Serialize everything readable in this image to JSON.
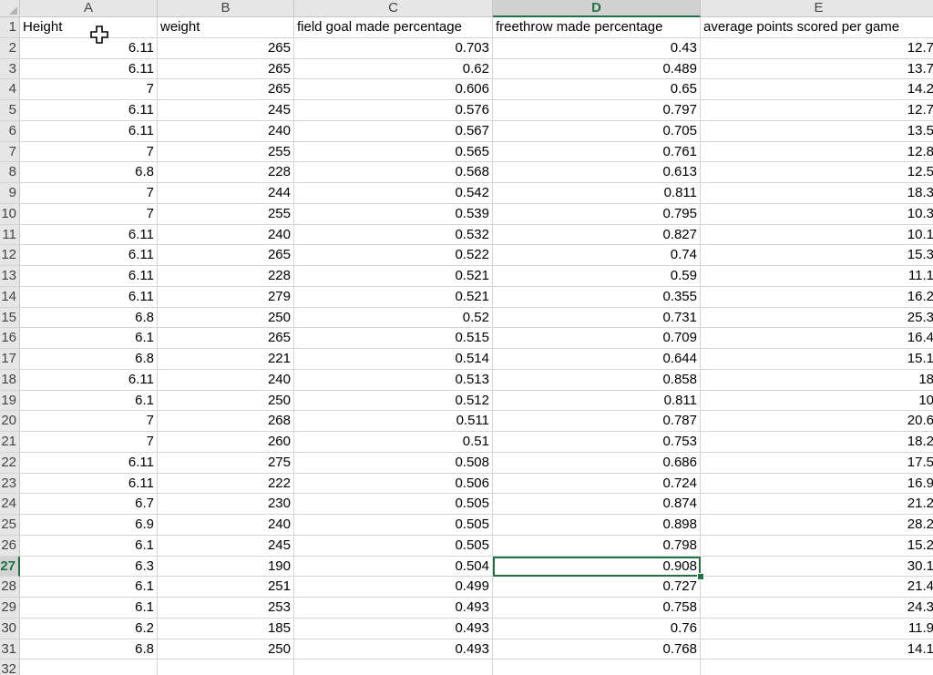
{
  "column_headers": [
    "A",
    "B",
    "C",
    "D",
    "E"
  ],
  "active_column": "D",
  "active_row": 27,
  "header_row": [
    "Height",
    "weight",
    "field goal made percentage",
    "freethrow made percentage",
    "average points scored per game"
  ],
  "rows": [
    [
      "6.11",
      "265",
      "0.703",
      "0.43",
      "12.7"
    ],
    [
      "6.11",
      "265",
      "0.62",
      "0.489",
      "13.7"
    ],
    [
      "7",
      "265",
      "0.606",
      "0.65",
      "14.2"
    ],
    [
      "6.11",
      "245",
      "0.576",
      "0.797",
      "12.7"
    ],
    [
      "6.11",
      "240",
      "0.567",
      "0.705",
      "13.5"
    ],
    [
      "7",
      "255",
      "0.565",
      "0.761",
      "12.8"
    ],
    [
      "6.8",
      "228",
      "0.568",
      "0.613",
      "12.5"
    ],
    [
      "7",
      "244",
      "0.542",
      "0.811",
      "18.3"
    ],
    [
      "7",
      "255",
      "0.539",
      "0.795",
      "10.3"
    ],
    [
      "6.11",
      "240",
      "0.532",
      "0.827",
      "10.1"
    ],
    [
      "6.11",
      "265",
      "0.522",
      "0.74",
      "15.3"
    ],
    [
      "6.11",
      "228",
      "0.521",
      "0.59",
      "11.1"
    ],
    [
      "6.11",
      "279",
      "0.521",
      "0.355",
      "16.2"
    ],
    [
      "6.8",
      "250",
      "0.52",
      "0.731",
      "25.3"
    ],
    [
      "6.1",
      "265",
      "0.515",
      "0.709",
      "16.4"
    ],
    [
      "6.8",
      "221",
      "0.514",
      "0.644",
      "15.1"
    ],
    [
      "6.11",
      "240",
      "0.513",
      "0.858",
      "18"
    ],
    [
      "6.1",
      "250",
      "0.512",
      "0.811",
      "10"
    ],
    [
      "7",
      "268",
      "0.511",
      "0.787",
      "20.6"
    ],
    [
      "7",
      "260",
      "0.51",
      "0.753",
      "18.2"
    ],
    [
      "6.11",
      "275",
      "0.508",
      "0.686",
      "17.5"
    ],
    [
      "6.11",
      "222",
      "0.506",
      "0.724",
      "16.9"
    ],
    [
      "6.7",
      "230",
      "0.505",
      "0.874",
      "21.2"
    ],
    [
      "6.9",
      "240",
      "0.505",
      "0.898",
      "28.2"
    ],
    [
      "6.1",
      "245",
      "0.505",
      "0.798",
      "15.2"
    ],
    [
      "6.3",
      "190",
      "0.504",
      "0.908",
      "30.1"
    ],
    [
      "6.1",
      "251",
      "0.499",
      "0.727",
      "21.4"
    ],
    [
      "6.1",
      "253",
      "0.493",
      "0.758",
      "24.3"
    ],
    [
      "6.2",
      "185",
      "0.493",
      "0.76",
      "11.9"
    ],
    [
      "6.8",
      "250",
      "0.493",
      "0.768",
      "14.1"
    ]
  ],
  "row_numbers": [
    "1",
    "2",
    "3",
    "4",
    "5",
    "6",
    "7",
    "8",
    "9",
    "10",
    "11",
    "12",
    "13",
    "14",
    "15",
    "16",
    "17",
    "18",
    "19",
    "20",
    "21",
    "22",
    "23",
    "24",
    "25",
    "26",
    "27",
    "28",
    "29",
    "30",
    "31",
    "32"
  ],
  "cursor": {
    "icon": "cell-select-cursor-icon"
  },
  "colors": {
    "accent": "#217346",
    "header_bg": "#e6e6e6",
    "active_header_bg": "#d2d2d2",
    "grid": "#d4d4d4"
  }
}
